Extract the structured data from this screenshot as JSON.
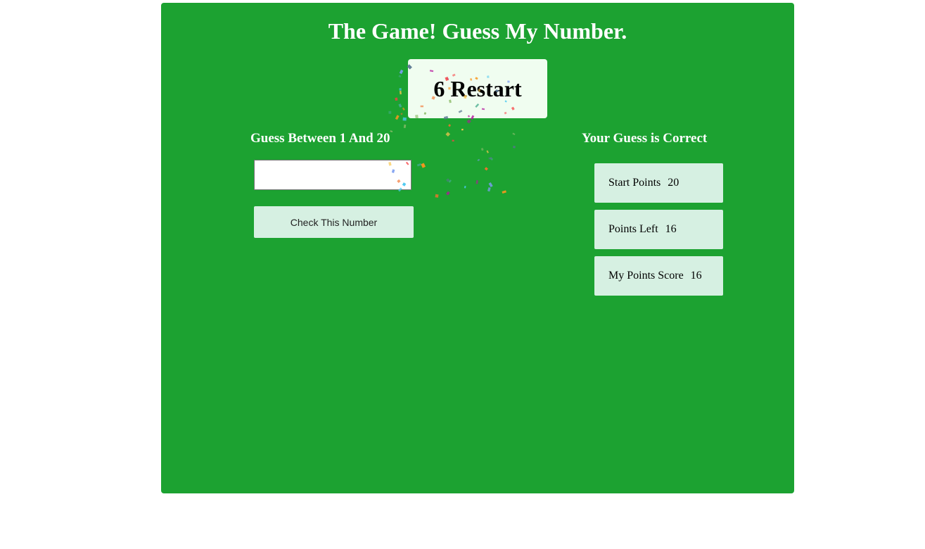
{
  "game": {
    "title": "The Game! Guess My Number.",
    "secret_number": "6",
    "restart_label": "Restart",
    "guess_range_label": "Guess Between 1 And 20",
    "input": {
      "value": "",
      "placeholder": ""
    },
    "check_button_label": "Check This Number",
    "result_message": "Your Guess is Correct"
  },
  "stats": {
    "start_points": {
      "label": "Start Points",
      "value": "20"
    },
    "points_left": {
      "label": "Points Left",
      "value": "16"
    },
    "score": {
      "label": "My Points Score",
      "value": "16"
    }
  },
  "colors": {
    "panel_bg": "#1ca231",
    "restart_bg": "#f0fdf0",
    "stat_bg": "#d6f0e2",
    "text_light": "#ffffff",
    "confetti": [
      "#f94144",
      "#f3722c",
      "#f8961e",
      "#f9c74f",
      "#90be6d",
      "#43aa8b",
      "#577590",
      "#4cc9f0",
      "#b5179e",
      "#7b9cf0"
    ]
  }
}
